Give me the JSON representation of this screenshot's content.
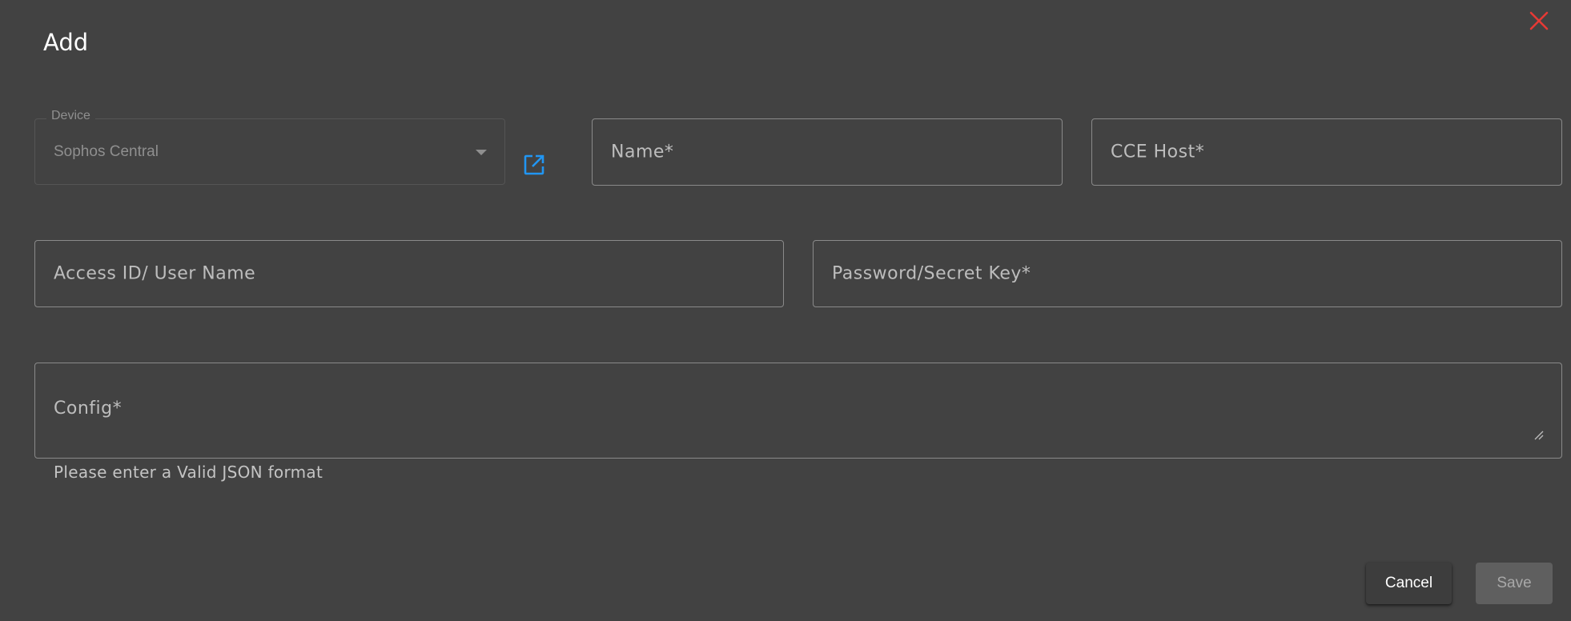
{
  "dialog": {
    "title": "Add",
    "close_icon": "close-icon"
  },
  "device": {
    "label": "Device",
    "value": "Sophos Central",
    "link_icon": "open-in-new-icon"
  },
  "fields": {
    "name_placeholder": "Name*",
    "cce_host_placeholder": "CCE Host*",
    "access_id_placeholder": "Access ID/ User Name",
    "password_placeholder": "Password/Secret Key*",
    "config_placeholder": "Config*",
    "config_helper": "Please enter a Valid JSON format"
  },
  "actions": {
    "cancel_label": "Cancel",
    "save_label": "Save"
  },
  "colors": {
    "background": "#424242",
    "close": "#e53935",
    "link": "#2196f3"
  }
}
